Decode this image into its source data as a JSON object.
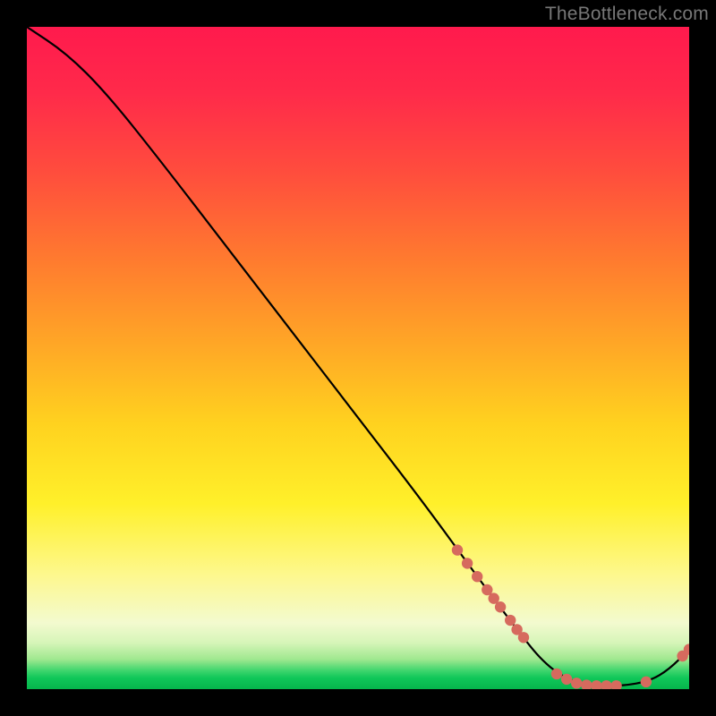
{
  "attribution": "TheBottleneck.com",
  "chart_data": {
    "type": "line",
    "title": "",
    "xlabel": "",
    "ylabel": "",
    "xlim": [
      0,
      100
    ],
    "ylim": [
      0,
      100
    ],
    "grid": false,
    "curve": [
      {
        "x": 0,
        "y": 100
      },
      {
        "x": 6,
        "y": 96
      },
      {
        "x": 12,
        "y": 90
      },
      {
        "x": 20,
        "y": 80
      },
      {
        "x": 30,
        "y": 67
      },
      {
        "x": 40,
        "y": 54
      },
      {
        "x": 50,
        "y": 41
      },
      {
        "x": 60,
        "y": 28
      },
      {
        "x": 68,
        "y": 17
      },
      {
        "x": 74,
        "y": 9
      },
      {
        "x": 78,
        "y": 4
      },
      {
        "x": 82,
        "y": 1.2
      },
      {
        "x": 86,
        "y": 0.5
      },
      {
        "x": 90,
        "y": 0.5
      },
      {
        "x": 94,
        "y": 1.2
      },
      {
        "x": 97,
        "y": 3
      },
      {
        "x": 100,
        "y": 6
      }
    ],
    "markers_cluster_top": [
      {
        "x": 65,
        "y": 21
      },
      {
        "x": 66.5,
        "y": 19
      },
      {
        "x": 68,
        "y": 17
      },
      {
        "x": 69.5,
        "y": 15
      },
      {
        "x": 70.5,
        "y": 13.7
      },
      {
        "x": 71.5,
        "y": 12.4
      },
      {
        "x": 73,
        "y": 10.4
      },
      {
        "x": 74,
        "y": 9
      },
      {
        "x": 75,
        "y": 7.8
      }
    ],
    "markers_cluster_bottom": [
      {
        "x": 80,
        "y": 2.3
      },
      {
        "x": 81.5,
        "y": 1.5
      },
      {
        "x": 83,
        "y": 0.9
      },
      {
        "x": 84.5,
        "y": 0.6
      },
      {
        "x": 86,
        "y": 0.5
      },
      {
        "x": 87.5,
        "y": 0.5
      },
      {
        "x": 89,
        "y": 0.5
      },
      {
        "x": 93.5,
        "y": 1.1
      }
    ],
    "markers_far_right": [
      {
        "x": 99,
        "y": 5
      },
      {
        "x": 100,
        "y": 6
      }
    ],
    "marker_color": "#d66a5e",
    "line_color": "#000000"
  }
}
